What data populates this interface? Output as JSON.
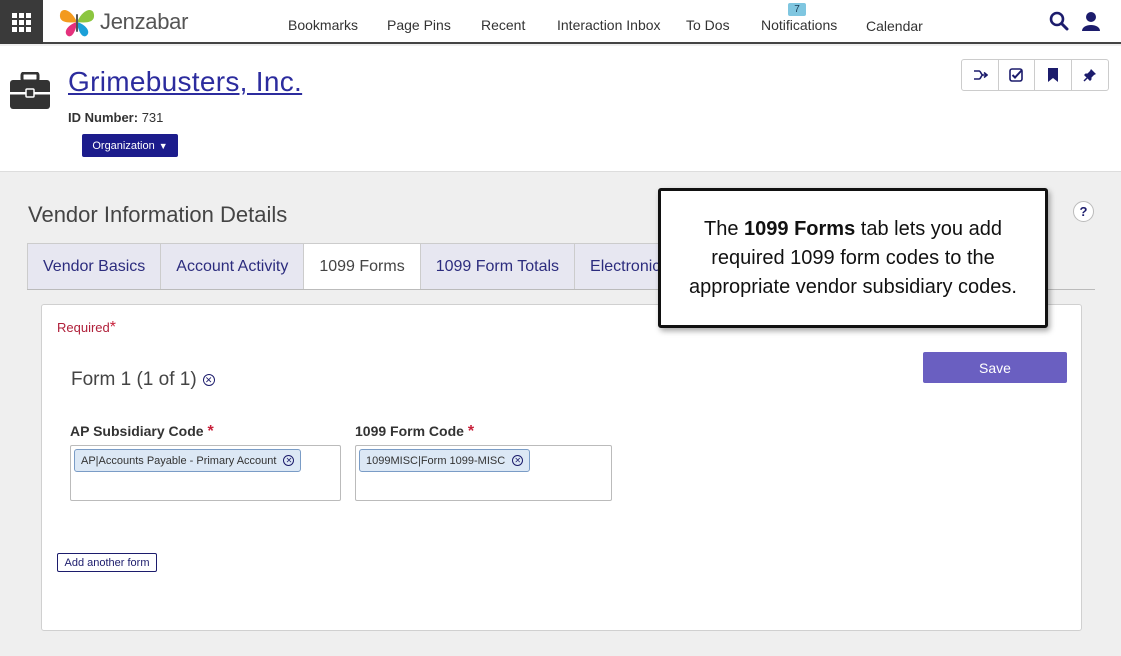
{
  "nav": {
    "logo_text": "Jenzabar",
    "items": [
      "Bookmarks",
      "Page Pins",
      "Recent",
      "Interaction Inbox",
      "To Dos",
      "Notifications",
      "Calendar"
    ],
    "notifications_count": "7"
  },
  "header": {
    "org_name": "Grimebusters, Inc.",
    "id_label": "ID Number:",
    "id_value": "731",
    "org_button": "Organization"
  },
  "main": {
    "section_title": "Vendor Information Details",
    "help": "?",
    "tabs": [
      {
        "label": "Vendor Basics"
      },
      {
        "label": "Account Activity"
      },
      {
        "label": "1099 Forms"
      },
      {
        "label": "1099 Form Totals"
      },
      {
        "label": "Electronic"
      }
    ],
    "required_label": "Required",
    "form_title": "Form 1 (1 of 1)",
    "save_label": "Save",
    "fields": {
      "ap_label": "AP Subsidiary Code",
      "ap_value": "AP|Accounts Payable - Primary Account",
      "form_label": "1099 Form Code",
      "form_value": "1099MISC|Form 1099-MISC"
    },
    "add_form_label": "Add another form"
  },
  "callout": {
    "pre": "The",
    "bold": "1099 Forms",
    "post": "tab lets you add required 1099 form codes to the appropriate vendor subsidiary codes."
  },
  "colors": {
    "brand_navy": "#1c1c8c",
    "link_blue": "#2c2c9e",
    "save_purple": "#6a5fc1",
    "required_red": "#c8203a"
  },
  "icons": [
    "apps-grid-icon",
    "search-icon",
    "user-icon",
    "briefcase-icon",
    "merge-icon",
    "todo-check-icon",
    "bookmark-icon",
    "pin-icon",
    "remove-circle-icon"
  ]
}
